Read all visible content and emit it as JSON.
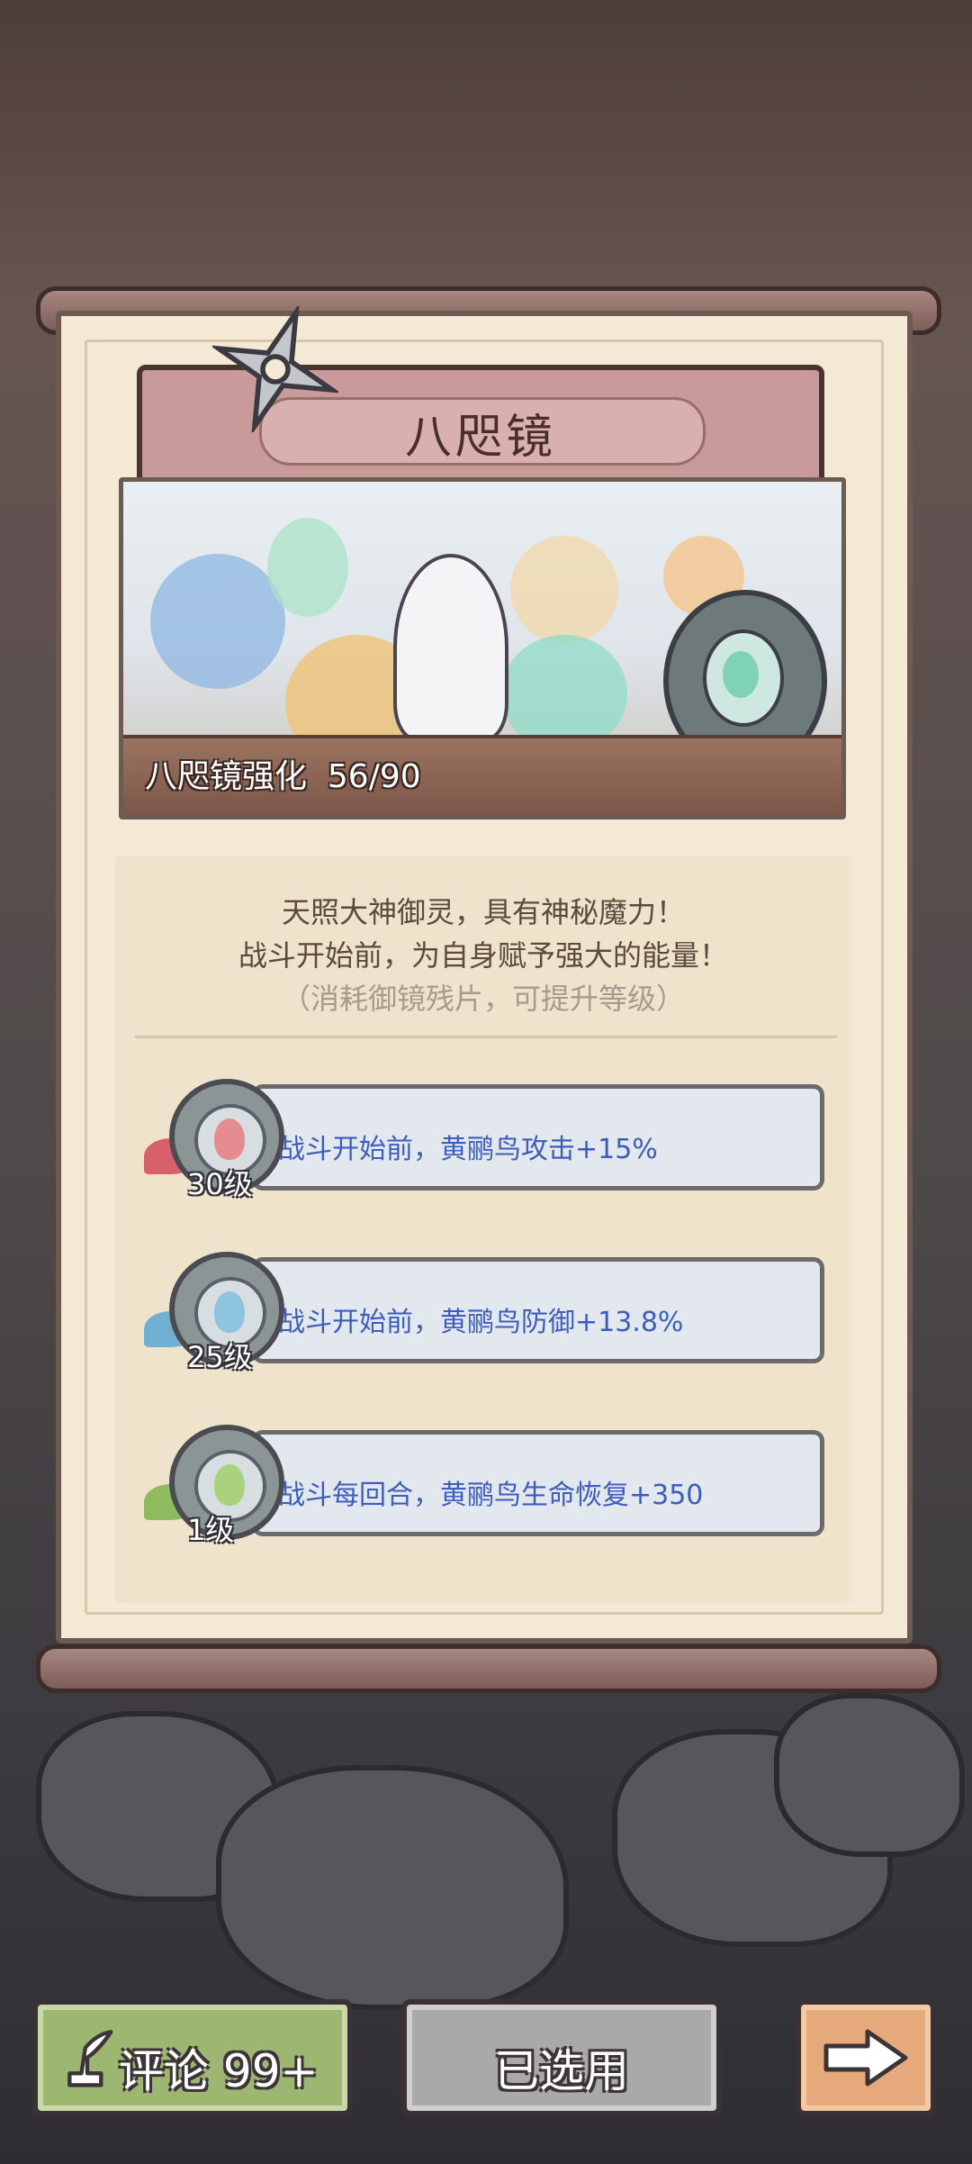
{
  "panel": {
    "title": "八咫镜",
    "progress_label": "八咫镜强化",
    "progress_value": "56/90",
    "progress_current": 56,
    "progress_max": 90
  },
  "description": {
    "line1": "天照大神御灵，具有神秘魔力！",
    "line2": "战斗开始前，为自身赋予强大的能量！",
    "hint": "（消耗御镜残片，可提升等级）"
  },
  "bonuses": [
    {
      "level": "30级",
      "text": "战斗开始前，黄鹂鸟攻击+15%",
      "color": "#e07f86"
    },
    {
      "level": "25级",
      "text": "战斗开始前，黄鹂鸟防御+13.8%",
      "color": "#7fb6d6"
    },
    {
      "level": "1级",
      "text": "战斗每回合，黄鹂鸟生命恢复+350",
      "color": "#9dc46e"
    }
  ],
  "buttons": {
    "comment_label": "评论 99+",
    "selected_label": "已选用"
  },
  "icons": {
    "comment": "quill-pen-icon",
    "next": "arrow-right-icon",
    "decor": "shuriken-icon"
  }
}
